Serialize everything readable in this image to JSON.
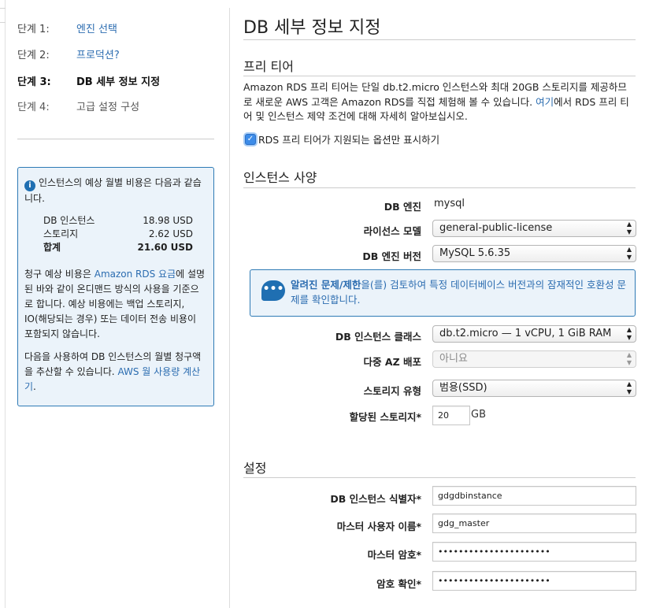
{
  "wizard": {
    "steps": [
      {
        "num": "단계 1:",
        "label": "엔진 선택",
        "state": "link"
      },
      {
        "num": "단계 2:",
        "label": "프로덕션?",
        "state": "link"
      },
      {
        "num": "단계 3:",
        "label": "DB 세부 정보 지정",
        "state": "current"
      },
      {
        "num": "단계 4:",
        "label": "고급 설정 구성",
        "state": "future"
      }
    ]
  },
  "cost_box": {
    "intro": "인스턴스의 예상 월별 비용은 다음과 같습니다.",
    "rows": [
      {
        "label": "DB 인스턴스",
        "value": "18.98 USD"
      },
      {
        "label": "스토리지",
        "value": "2.62 USD"
      },
      {
        "label": "합계",
        "value": "21.60 USD"
      }
    ],
    "para1_prefix": "청구 예상 비용은 ",
    "para1_link": "Amazon RDS 요금",
    "para1_suffix": "에 설명된 바와 같이 온디맨드 방식의 사용을 기준으로 합니다. 예상 비용에는 백업 스토리지, IO(해당되는 경우) 또는 데이터 전송 비용이 포함되지 않습니다.",
    "para2_prefix": "다음을 사용하여 DB 인스턴스의 월별 청구액을 추산할 수 있습니다. ",
    "para2_link": "AWS 월 사용량 계산기",
    "para2_suffix": "."
  },
  "main": {
    "title": "DB 세부 정보 지정",
    "free_tier": {
      "heading": "프리 티어",
      "text_prefix": "Amazon RDS 프리 티어는 단일 db.t2.micro 인스턴스와 최대 20GB 스토리지를 제공하므로 새로운 AWS 고객은 Amazon RDS를 직접 체험해 볼 수 있습니다. ",
      "text_link": "여기",
      "text_suffix": "에서 RDS 프리 티어 및 인스턴스 제약 조건에 대해 자세히 알아보십시오.",
      "checkbox_label": "RDS 프리 티어가 지원되는 옵션만 표시하기",
      "checkbox_checked": true
    },
    "instance_spec": {
      "heading": "인스턴스 사양",
      "db_engine_label": "DB 엔진",
      "db_engine_value": "mysql",
      "license_label": "라이선스 모델",
      "license_value": "general-public-license",
      "engine_version_label": "DB 엔진 버전",
      "engine_version_value": "MySQL 5.6.35",
      "notice_bold": "알려진 문제/제한",
      "notice_text": "을(를) 검토하여 특정 데이터베이스 버전과의 잠재적인 호환성 문제를 확인합니다.",
      "instance_class_label": "DB 인스턴스 클래스",
      "instance_class_value": "db.t2.micro — 1 vCPU, 1 GiB RAM",
      "multi_az_label": "다중 AZ 배포",
      "multi_az_value": "아니요",
      "storage_type_label": "스토리지 유형",
      "storage_type_value": "범용(SSD)",
      "allocated_storage_label": "할당된 스토리지*",
      "allocated_storage_value": "20",
      "allocated_storage_unit": "GB"
    },
    "settings": {
      "heading": "설정",
      "identifier_label": "DB 인스턴스 식별자*",
      "identifier_value": "gdgdbinstance",
      "master_user_label": "마스터 사용자 이름*",
      "master_user_value": "gdg_master",
      "master_password_label": "마스터 암호*",
      "master_password_value": "••••••••••••••••••••••",
      "confirm_password_label": "암호 확인*",
      "confirm_password_value": "••••••••••••••••••••••"
    }
  },
  "colors": {
    "link": "#2b6cb0",
    "info_bg": "#ebf3fa",
    "info_border": "#2e7ab5"
  }
}
